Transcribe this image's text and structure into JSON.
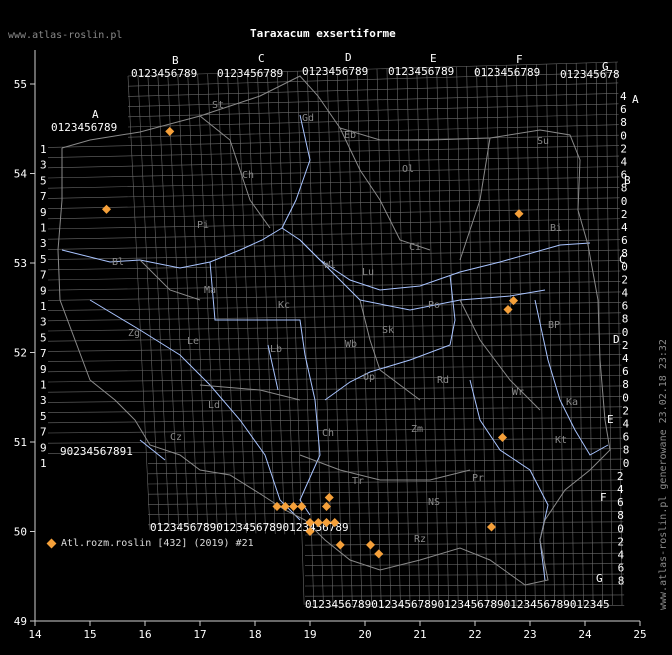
{
  "header": {
    "site": "www.atlas-roslin.pl",
    "title": "Taraxacum exsertiforme"
  },
  "legend": {
    "label": "Atl.rozm.roslin [432] (2019) #21",
    "marker_color": "#f5a03a"
  },
  "footer": {
    "generated": "www.atlas-roslin.pl generowane 23.02.18 23:32"
  },
  "axes": {
    "x_ticks": [
      "14",
      "15",
      "16",
      "17",
      "18",
      "19",
      "20",
      "21",
      "22",
      "23",
      "24",
      "25"
    ],
    "y_ticks": [
      "55",
      "54",
      "53",
      "52",
      "51",
      "50",
      "49"
    ],
    "x_range": [
      14,
      25
    ],
    "y_range": [
      49,
      55.5
    ]
  },
  "grid_letters_top": [
    "A",
    "B",
    "C",
    "D",
    "E",
    "F",
    "G"
  ],
  "grid_letters_right": [
    "A",
    "B",
    "C",
    "D",
    "E",
    "F",
    "G"
  ],
  "grid_digit_row": "0123456789",
  "grid_digit_col_A": [
    "1",
    "3",
    "5",
    "7",
    "9",
    "1",
    "3",
    "5",
    "7",
    "9",
    "1",
    "3",
    "5",
    "7",
    "9",
    "1",
    "3",
    "5",
    "7",
    "9",
    "1",
    "3",
    "5",
    "7"
  ],
  "grid_digit_col_right": [
    "4",
    "6",
    "8",
    "0",
    "2",
    "4",
    "6",
    "8",
    "0",
    "2",
    "4",
    "6",
    "8",
    "0",
    "2",
    "4",
    "6",
    "8",
    "0",
    "2",
    "4",
    "6",
    "8",
    "0",
    "2",
    "4",
    "6",
    "8",
    "0",
    "2",
    "4",
    "6",
    "8",
    "0",
    "2",
    "4",
    "6",
    "8"
  ],
  "region_labels": [
    "St",
    "Gd",
    "Eb",
    "Su",
    "Ch",
    "Ol",
    "Bi",
    "Pi",
    "Ci",
    "Wl",
    "Bl",
    "Ma",
    "Kc",
    "Lu",
    "Zg",
    "Le",
    "BP",
    "Sk",
    "Po",
    "Lb",
    "Op",
    "Rd",
    "Wr",
    "Ld",
    "Wb",
    "Cz",
    "Ch",
    "Ka",
    "Zm",
    "Kt",
    "Tr",
    "NS",
    "Rz",
    "Pr"
  ],
  "records": [
    {
      "lon": 16.45,
      "lat": 54.47
    },
    {
      "lon": 15.3,
      "lat": 53.6
    },
    {
      "lon": 22.8,
      "lat": 53.55
    },
    {
      "lon": 22.6,
      "lat": 52.48
    },
    {
      "lon": 22.7,
      "lat": 52.58
    },
    {
      "lon": 22.5,
      "lat": 51.05
    },
    {
      "lon": 18.4,
      "lat": 50.28
    },
    {
      "lon": 18.55,
      "lat": 50.28
    },
    {
      "lon": 18.7,
      "lat": 50.28
    },
    {
      "lon": 18.85,
      "lat": 50.28
    },
    {
      "lon": 19.35,
      "lat": 50.38
    },
    {
      "lon": 19.3,
      "lat": 50.28
    },
    {
      "lon": 19.0,
      "lat": 50.1
    },
    {
      "lon": 19.15,
      "lat": 50.1
    },
    {
      "lon": 19.3,
      "lat": 50.1
    },
    {
      "lon": 19.45,
      "lat": 50.1
    },
    {
      "lon": 19.0,
      "lat": 50.0
    },
    {
      "lon": 19.55,
      "lat": 49.85
    },
    {
      "lon": 20.1,
      "lat": 49.85
    },
    {
      "lon": 20.25,
      "lat": 49.75
    },
    {
      "lon": 22.3,
      "lat": 50.05
    }
  ]
}
